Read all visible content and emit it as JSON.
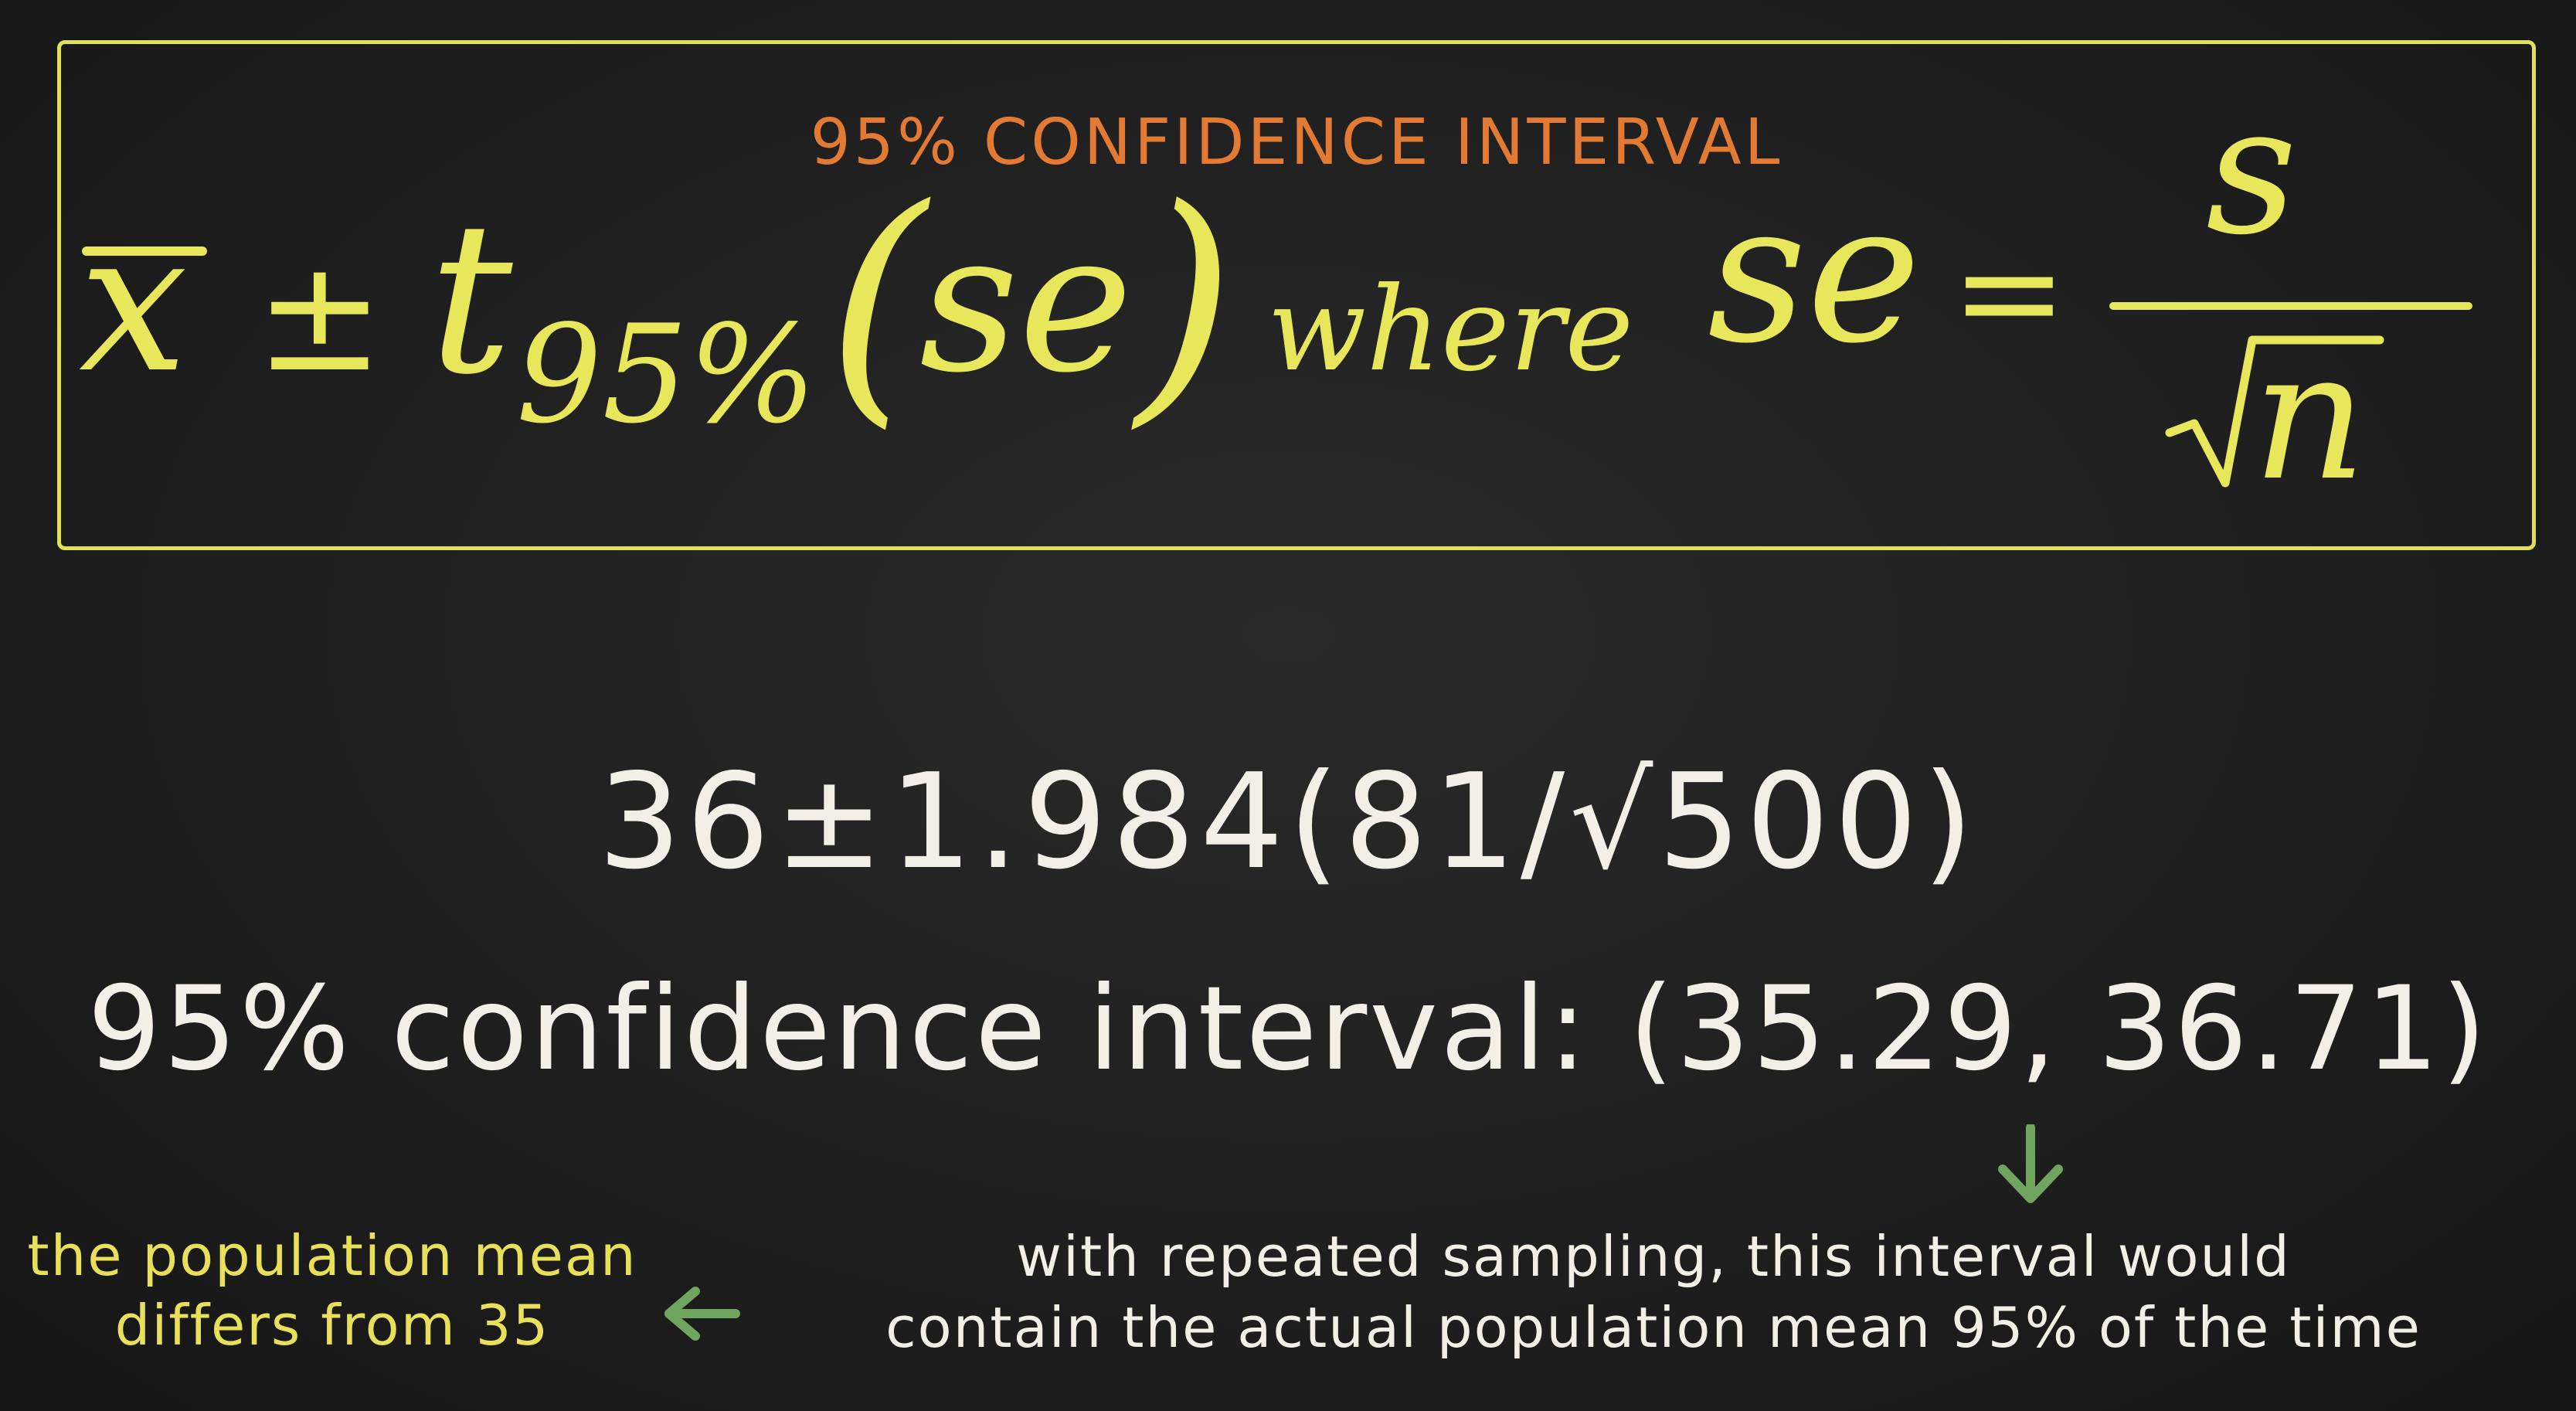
{
  "header": {
    "title": "95% CONFIDENCE INTERVAL"
  },
  "formula": {
    "x_bar": "x",
    "plus_minus": "±",
    "t": "t",
    "t_subscript": "95%",
    "open_paren": "(",
    "se_inner": "se",
    "close_paren": ")",
    "where": "where",
    "se_lhs": "se",
    "equals": "=",
    "numerator": "s",
    "denominator": "n"
  },
  "computation": {
    "text": "36±1.984(81/√500)"
  },
  "result": {
    "text": "95% confidence interval: (35.29, 36.71)"
  },
  "notes": {
    "left_line1": "the population mean",
    "left_line2": "differs from 35",
    "right_line1": "with repeated sampling, this interval would",
    "right_line2": "contain the actual population mean 95% of the time"
  },
  "colors": {
    "background": "#1e1e1e",
    "frame": "#e2e05a",
    "title": "#e27a33",
    "formula": "#e8e65a",
    "chalk": "#f1efe6",
    "arrow": "#6fa55e",
    "note_yellow": "#e8df5a"
  },
  "icons": {
    "down_arrow": "arrow-down-icon",
    "left_arrow": "arrow-left-icon"
  }
}
